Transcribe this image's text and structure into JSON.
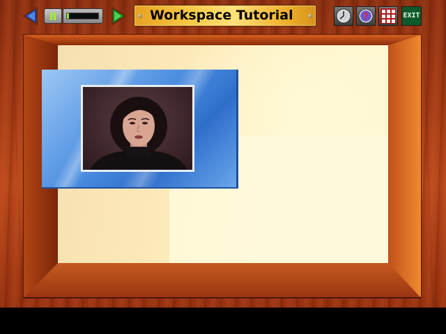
{
  "toolbar": {
    "title": "Workspace Tutorial",
    "back_icon": "left-arrow-icon",
    "forward_icon": "right-arrow-icon",
    "pause_icon": "pause-icon",
    "progress": 0.06,
    "exit_label": "EXIT",
    "buttons": [
      {
        "id": "clock",
        "icon": "clock-icon"
      },
      {
        "id": "help",
        "icon": "question-mark-icon"
      },
      {
        "id": "grid",
        "icon": "grid-icon"
      },
      {
        "id": "exit",
        "icon": "exit-sign-icon"
      }
    ]
  },
  "video": {
    "content": "presenter-video",
    "colors": {
      "frame": "#4d8fe0",
      "accent": "#9cf22a"
    }
  }
}
